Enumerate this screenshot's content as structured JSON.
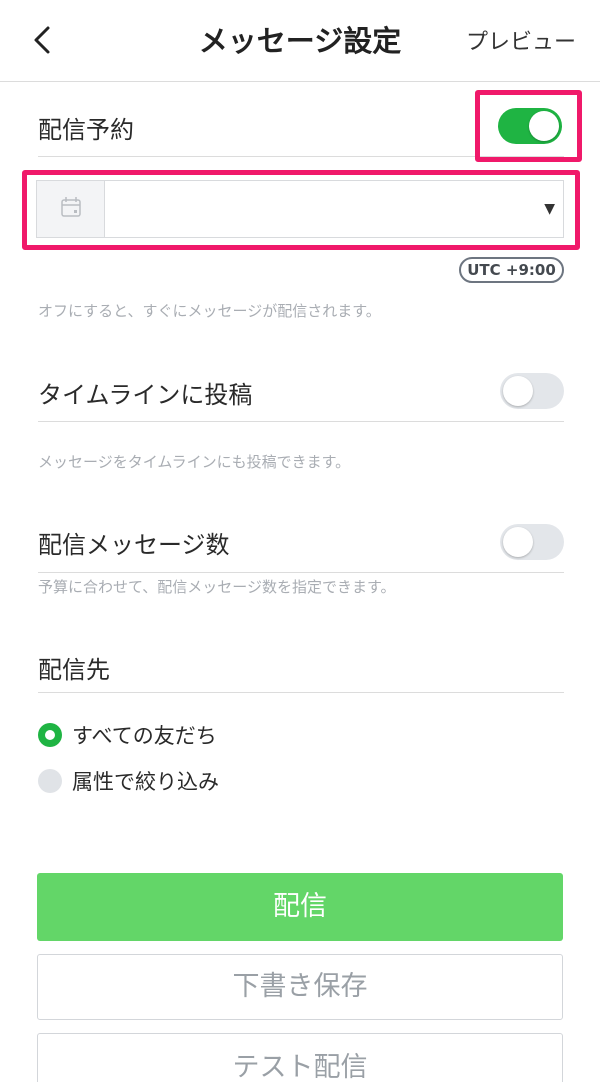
{
  "header": {
    "back_icon": "chevron-left-icon",
    "title": "メッセージ設定",
    "preview_label": "プレビュー"
  },
  "schedule": {
    "label": "配信予約",
    "toggle_on": true,
    "date_value": "",
    "calendar_icon": "calendar-icon",
    "timezone": "UTC +9:00",
    "helper": "オフにすると、すぐにメッセージが配信されます。"
  },
  "timeline": {
    "label": "タイムラインに投稿",
    "toggle_on": false,
    "helper": "メッセージをタイムラインにも投稿できます。"
  },
  "message_count": {
    "label": "配信メッセージ数",
    "toggle_on": false,
    "helper": "予算に合わせて、配信メッセージ数を指定できます。"
  },
  "recipients": {
    "label": "配信先",
    "options": [
      {
        "label": "すべての友だち",
        "checked": true
      },
      {
        "label": "属性で絞り込み",
        "checked": false
      }
    ]
  },
  "actions": {
    "send_label": "配信",
    "save_draft_label": "下書き保存",
    "test_send_label": "テスト配信"
  },
  "colors": {
    "accent_green": "#1fb443",
    "send_button": "#63d668",
    "highlight": "#f0196a"
  }
}
